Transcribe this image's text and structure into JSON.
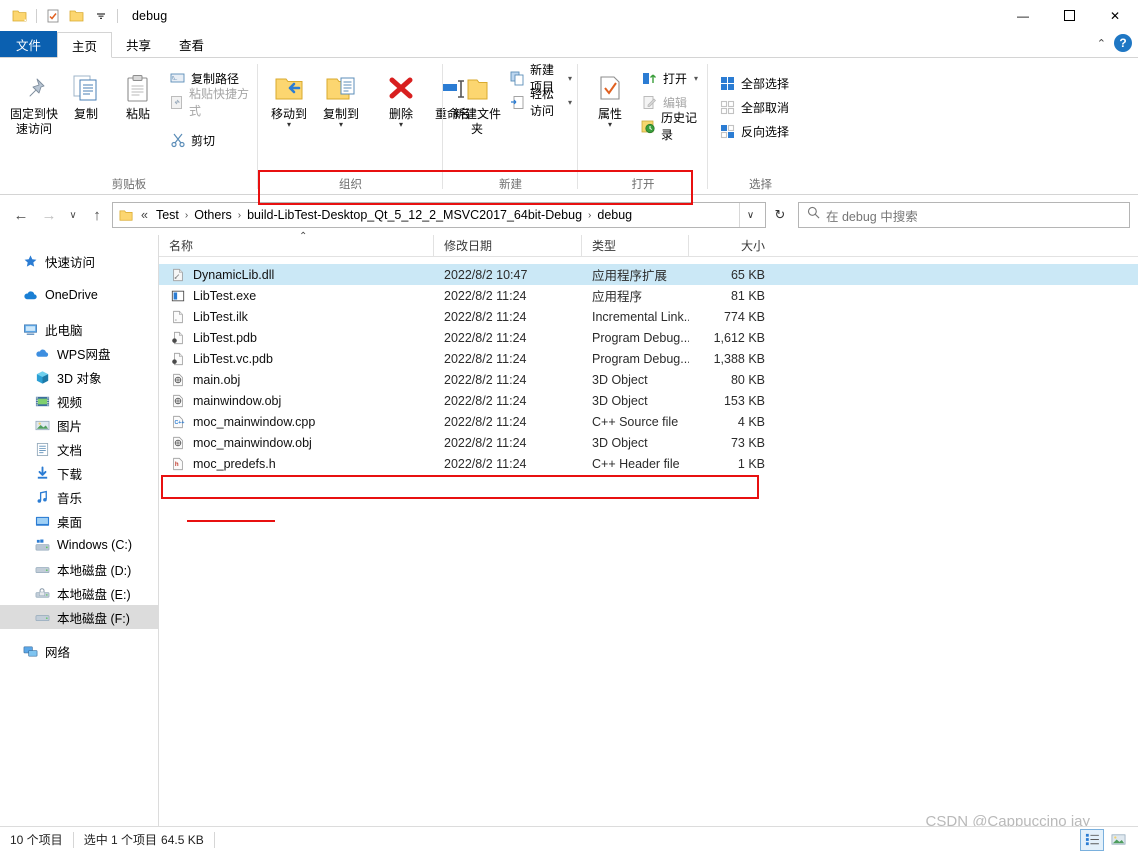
{
  "window": {
    "title": "debug",
    "quick_access": [
      {
        "name": "folder-icon",
        "label": "属性"
      },
      {
        "name": "properties-icon",
        "label": "属性"
      },
      {
        "name": "new-folder-icon",
        "label": "新建文件夹"
      }
    ],
    "controls": {
      "minimize": "—",
      "maximize": "☐",
      "close": "✕"
    }
  },
  "tabs": [
    {
      "id": "file",
      "label": "文件"
    },
    {
      "id": "home",
      "label": "主页"
    },
    {
      "id": "share",
      "label": "共享"
    },
    {
      "id": "view",
      "label": "查看"
    }
  ],
  "tab_right": {
    "collapse": "⌃",
    "help": "?"
  },
  "ribbon": {
    "groups": [
      {
        "label": "剪贴板",
        "big": [
          {
            "label": "固定到快速访问",
            "icon": "pin-icon"
          },
          {
            "label": "复制",
            "icon": "copy-icon"
          },
          {
            "label": "粘贴",
            "icon": "paste-icon"
          }
        ],
        "small": [
          {
            "label": "复制路径",
            "icon": "copy-path-icon",
            "dim": false
          },
          {
            "label": "粘贴快捷方式",
            "icon": "paste-shortcut-icon",
            "dim": true
          }
        ],
        "cut": {
          "label": "剪切",
          "icon": "scissors-icon"
        }
      },
      {
        "label": "组织",
        "big": [
          {
            "label": "移动到",
            "icon": "move-to-icon",
            "caret": true
          },
          {
            "label": "复制到",
            "icon": "copy-to-icon",
            "caret": true
          },
          {
            "label": "删除",
            "icon": "delete-icon",
            "caret": true
          },
          {
            "label": "重命名",
            "icon": "rename-icon",
            "caret": false
          }
        ]
      },
      {
        "label": "新建",
        "big": [
          {
            "label": "新建文件夹",
            "icon": "new-folder-icon"
          }
        ],
        "small": [
          {
            "label": "新建项目",
            "icon": "new-item-icon",
            "caret": true
          },
          {
            "label": "轻松访问",
            "icon": "easy-access-icon",
            "caret": true
          }
        ]
      },
      {
        "label": "打开",
        "big": [
          {
            "label": "属性",
            "icon": "properties-icon",
            "caret": true
          }
        ],
        "small": [
          {
            "label": "打开",
            "icon": "open-icon",
            "caret": true,
            "dim": false
          },
          {
            "label": "编辑",
            "icon": "edit-icon",
            "caret": false,
            "dim": true
          },
          {
            "label": "历史记录",
            "icon": "history-icon",
            "caret": false,
            "dim": false
          }
        ]
      },
      {
        "label": "选择",
        "small": [
          {
            "label": "全部选择",
            "icon": "select-all-icon",
            "dim": false
          },
          {
            "label": "全部取消",
            "icon": "select-none-icon",
            "dim": true
          },
          {
            "label": "反向选择",
            "icon": "invert-selection-icon",
            "dim": false
          }
        ]
      }
    ]
  },
  "address": {
    "back": "←",
    "forward": "→",
    "recent": "∨",
    "up": "↑",
    "ellipsis": "«",
    "crumbs": [
      "Test",
      "Others",
      "build-LibTest-Desktop_Qt_5_12_2_MSVC2017_64bit-Debug",
      "debug"
    ],
    "separator": "›",
    "dropdown": "∨",
    "refresh": "↻"
  },
  "search": {
    "placeholder": "在 debug 中搜索",
    "icon": "search-icon"
  },
  "nav_pane": {
    "items": [
      {
        "label": "快速访问",
        "icon": "star-icon",
        "level": 1,
        "selected": false,
        "gap_after": true
      },
      {
        "label": "OneDrive",
        "icon": "cloud-icon",
        "level": 1,
        "selected": false,
        "gap_after": true
      },
      {
        "label": "此电脑",
        "icon": "computer-icon",
        "level": 1,
        "selected": false,
        "gap_after": false
      },
      {
        "label": "WPS网盘",
        "icon": "wps-cloud-icon",
        "level": 2,
        "selected": false,
        "gap_after": false
      },
      {
        "label": "3D 对象",
        "icon": "3d-object-icon",
        "level": 2,
        "selected": false,
        "gap_after": false
      },
      {
        "label": "视频",
        "icon": "video-icon",
        "level": 2,
        "selected": false,
        "gap_after": false
      },
      {
        "label": "图片",
        "icon": "picture-icon",
        "level": 2,
        "selected": false,
        "gap_after": false
      },
      {
        "label": "文档",
        "icon": "document-icon",
        "level": 2,
        "selected": false,
        "gap_after": false
      },
      {
        "label": "下载",
        "icon": "download-icon",
        "level": 2,
        "selected": false,
        "gap_after": false
      },
      {
        "label": "音乐",
        "icon": "music-icon",
        "level": 2,
        "selected": false,
        "gap_after": false
      },
      {
        "label": "桌面",
        "icon": "desktop-icon",
        "level": 2,
        "selected": false,
        "gap_after": false
      },
      {
        "label": "Windows (C:)",
        "icon": "windows-drive-icon",
        "level": 2,
        "selected": false,
        "gap_after": false
      },
      {
        "label": "本地磁盘 (D:)",
        "icon": "drive-icon",
        "level": 2,
        "selected": false,
        "gap_after": false
      },
      {
        "label": "本地磁盘 (E:)",
        "icon": "drive-locked-icon",
        "level": 2,
        "selected": false,
        "gap_after": false
      },
      {
        "label": "本地磁盘 (F:)",
        "icon": "drive-icon",
        "level": 2,
        "selected": true,
        "gap_after": true
      },
      {
        "label": "网络",
        "icon": "network-icon",
        "level": 1,
        "selected": false,
        "gap_after": false
      }
    ]
  },
  "file_list": {
    "columns": [
      "名称",
      "修改日期",
      "类型",
      "大小"
    ],
    "sort_indicator": "⌃",
    "rows": [
      {
        "name": "DynamicLib.dll",
        "date": "2022/8/2 10:47",
        "type": "应用程序扩展",
        "size": "65 KB",
        "icon": "dll-icon",
        "selected": true
      },
      {
        "name": "LibTest.exe",
        "date": "2022/8/2 11:24",
        "type": "应用程序",
        "size": "81 KB",
        "icon": "exe-icon",
        "selected": false
      },
      {
        "name": "LibTest.ilk",
        "date": "2022/8/2 11:24",
        "type": "Incremental Link...",
        "size": "774 KB",
        "icon": "ilk-icon",
        "selected": false
      },
      {
        "name": "LibTest.pdb",
        "date": "2022/8/2 11:24",
        "type": "Program Debug...",
        "size": "1,612 KB",
        "icon": "pdb-icon",
        "selected": false
      },
      {
        "name": "LibTest.vc.pdb",
        "date": "2022/8/2 11:24",
        "type": "Program Debug...",
        "size": "1,388 KB",
        "icon": "pdb-icon",
        "selected": false
      },
      {
        "name": "main.obj",
        "date": "2022/8/2 11:24",
        "type": "3D Object",
        "size": "80 KB",
        "icon": "obj-icon",
        "selected": false
      },
      {
        "name": "mainwindow.obj",
        "date": "2022/8/2 11:24",
        "type": "3D Object",
        "size": "153 KB",
        "icon": "obj-icon",
        "selected": false
      },
      {
        "name": "moc_mainwindow.cpp",
        "date": "2022/8/2 11:24",
        "type": "C++ Source file",
        "size": "4 KB",
        "icon": "cpp-icon",
        "selected": false
      },
      {
        "name": "moc_mainwindow.obj",
        "date": "2022/8/2 11:24",
        "type": "3D Object",
        "size": "73 KB",
        "icon": "obj-icon",
        "selected": false
      },
      {
        "name": "moc_predefs.h",
        "date": "2022/8/2 11:24",
        "type": "C++ Header file",
        "size": "1 KB",
        "icon": "header-icon",
        "selected": false
      }
    ]
  },
  "status": {
    "item_count": "10 个项目",
    "selected_info": "选中 1 个项目",
    "selected_size": "64.5 KB"
  },
  "watermark": "CSDN @Cappuccino jay",
  "view_buttons": [
    {
      "name": "details-view-button",
      "active": true
    },
    {
      "name": "large-icons-view-button",
      "active": false
    }
  ],
  "colors": {
    "accent": "#0b60b0",
    "selection": "#cbe8f6",
    "annotation": "#e81010",
    "folder": "#fcd670"
  }
}
